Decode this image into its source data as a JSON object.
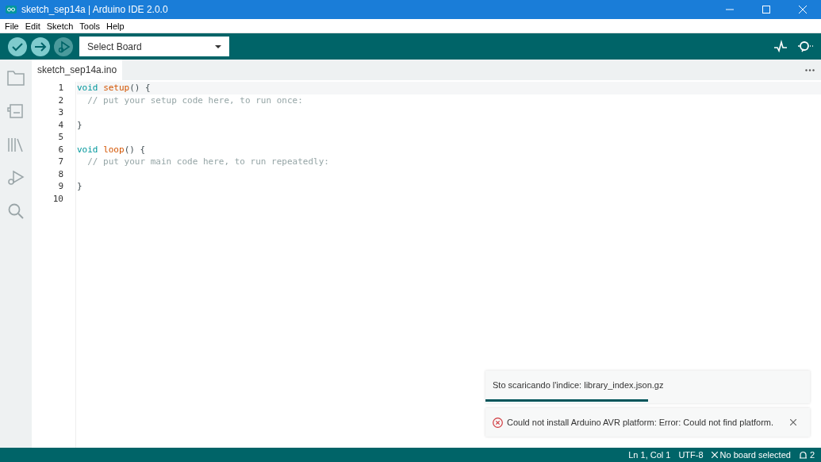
{
  "window": {
    "title": "sketch_sep14a | Arduino IDE 2.0.0"
  },
  "menu": [
    "File",
    "Edit",
    "Sketch",
    "Tools",
    "Help"
  ],
  "toolbar": {
    "buttons": [
      {
        "kind": "verify",
        "disabled": false
      },
      {
        "kind": "upload",
        "disabled": false
      },
      {
        "kind": "debug",
        "disabled": true
      }
    ],
    "board_select": {
      "value": "Select Board"
    }
  },
  "tabs": [
    {
      "label": "sketch_sep14a.ino",
      "selected": true
    }
  ],
  "editor": {
    "lines": [
      {
        "number": "1",
        "tokens": [
          {
            "kind": "keyword",
            "text": "void "
          },
          {
            "kind": "function",
            "text": "setup"
          },
          {
            "kind": "plain",
            "text": "() {"
          }
        ]
      },
      {
        "number": "2",
        "tokens": [
          {
            "kind": "comment",
            "text": "  // put your setup code here, to run once:"
          }
        ]
      },
      {
        "number": "3"
      },
      {
        "number": "4",
        "tokens": [
          {
            "kind": "plain",
            "text": "}"
          }
        ]
      },
      {
        "number": "5"
      },
      {
        "number": "6",
        "tokens": [
          {
            "kind": "keyword",
            "text": "void "
          },
          {
            "kind": "function",
            "text": "loop"
          },
          {
            "kind": "plain",
            "text": "() {"
          }
        ]
      },
      {
        "number": "7",
        "tokens": [
          {
            "kind": "comment",
            "text": "  // put your main code here, to run repeatedly:"
          }
        ]
      },
      {
        "number": "8"
      },
      {
        "number": "9",
        "tokens": [
          {
            "kind": "plain",
            "text": "}"
          }
        ]
      },
      {
        "number": "10"
      }
    ]
  },
  "notifications": [
    {
      "kind": "progress",
      "text": "Sto scaricando l'indice: library_index.json.gz",
      "level": 0.5
    },
    {
      "kind": "error",
      "text": "Could not install Arduino AVR platform: Error: Could not find platform."
    }
  ],
  "status_bar": {
    "position": "Ln 1, Col 1",
    "encoding": "UTF-8",
    "board": "No board selected",
    "notification_count": "2"
  }
}
